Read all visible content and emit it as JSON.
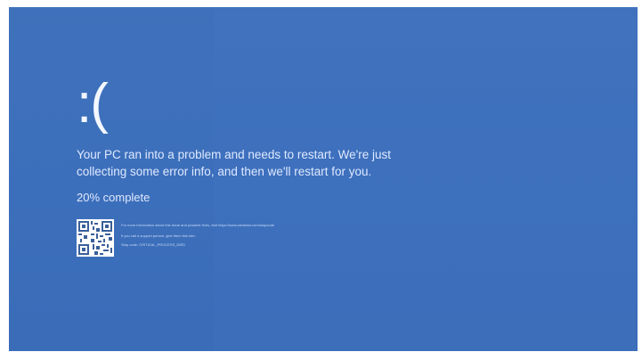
{
  "screen": {
    "face": ":(",
    "message": "Your PC ran into a problem and needs to restart. We're just collecting some error info, and then we'll restart for you.",
    "progress_percent": 20,
    "progress_text": "20% complete",
    "colors": {
      "background": "#3f71bb",
      "text": "#dfe9ff"
    }
  },
  "info": {
    "qr_icon": "qr-code-icon",
    "more_info": "For more information about this issue and possible fixes, visit https://www.windows.com/stopcode",
    "support_line": "If you call a support person, give them this info:",
    "stop_code": "Stop code: CRITICAL_PROCESS_DIED"
  }
}
